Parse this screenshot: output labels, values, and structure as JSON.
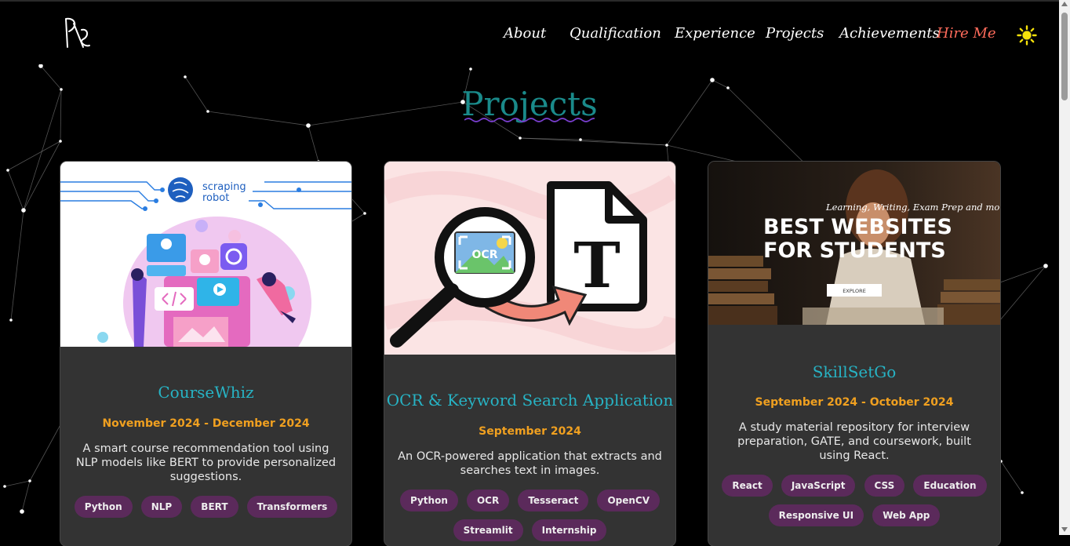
{
  "nav": {
    "items": [
      "About",
      "Qualification",
      "Experience",
      "Projects",
      "Achievements"
    ],
    "hire_label": "Hire Me"
  },
  "section": {
    "title": "Projects"
  },
  "projects": [
    {
      "title": "CourseWhiz",
      "date": "November 2024 - December 2024",
      "description": "A smart course recommendation tool using NLP models like BERT to provide personalized suggestions.",
      "tags": [
        "Python",
        "NLP",
        "BERT",
        "Transformers"
      ],
      "image_brand_line1": "scraping",
      "image_brand_line2": "robot"
    },
    {
      "title": "OCR & Keyword Search Application",
      "date": "September 2024",
      "description": "An OCR-powered application that extracts and searches text in images.",
      "tags": [
        "Python",
        "OCR",
        "Tesseract",
        "OpenCV",
        "Streamlit",
        "Internship"
      ],
      "image_ocr_label": "OCR",
      "image_doc_letter": "T"
    },
    {
      "title": "SkillSetGo",
      "date": "September 2024 - October 2024",
      "description": "A study material repository for interview preparation, GATE, and coursework, built using React.",
      "tags": [
        "React",
        "JavaScript",
        "CSS",
        "Education",
        "Responsive UI",
        "Web App"
      ],
      "image_kicker": "Learning, Writing, Exam Prep and more.",
      "image_headline1": "BEST WEBSITES",
      "image_headline2": "FOR STUDENTS",
      "image_button": "EXPLORE"
    }
  ],
  "colors": {
    "accent": "#1a8a8a",
    "title": "#27b3c4",
    "date": "#f0a020",
    "tag_bg": "#5b2a5b",
    "hire": "#ff6b5b",
    "sun": "#f5e10a"
  }
}
